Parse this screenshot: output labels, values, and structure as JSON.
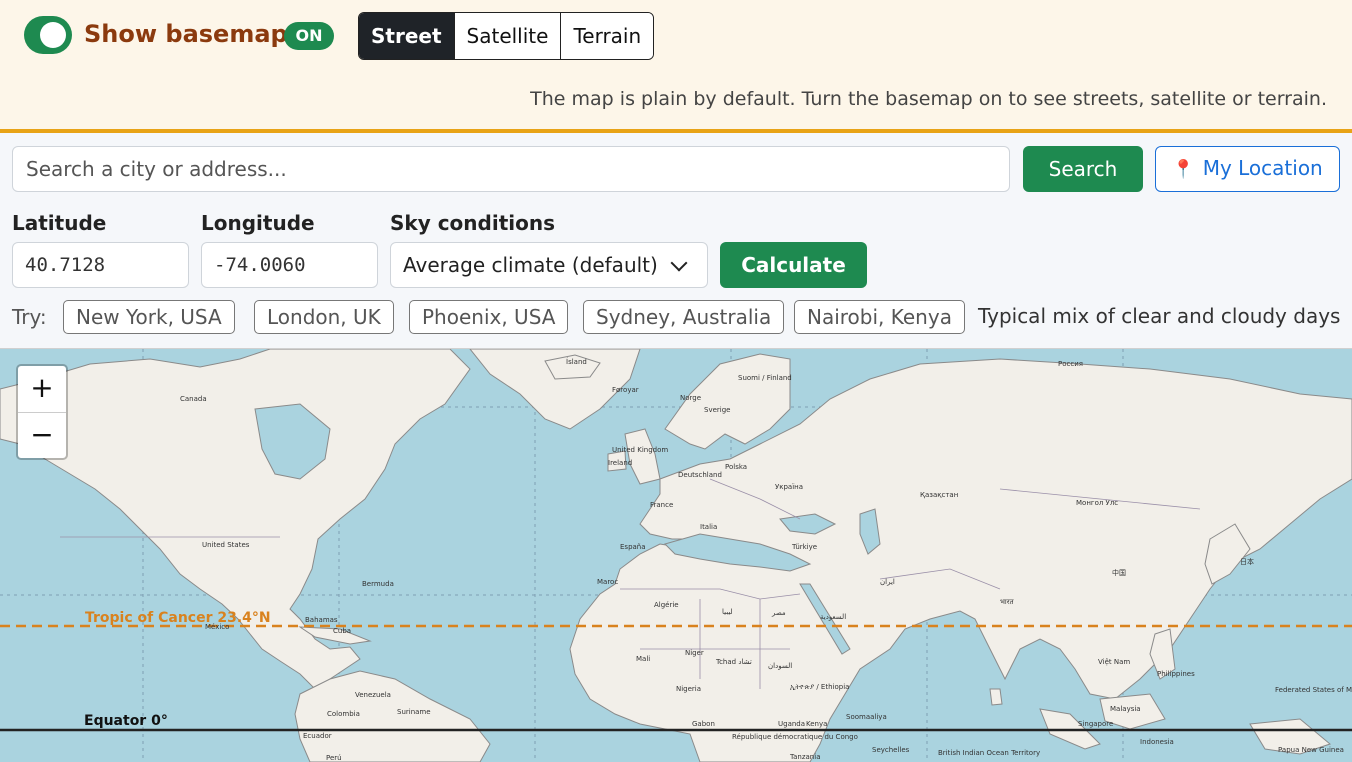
{
  "basemap_toggle": {
    "label": "Show basemap",
    "state": "ON"
  },
  "basemap_styles": [
    {
      "label": "Street",
      "active": true
    },
    {
      "label": "Satellite",
      "active": false
    },
    {
      "label": "Terrain",
      "active": false
    }
  ],
  "hint": "The map is plain by default. Turn the basemap on to see streets, satellite or terrain.",
  "search": {
    "placeholder": "Search a city or address...",
    "button": "Search",
    "location_button": "My Location",
    "location_icon": "pin-icon"
  },
  "fields": {
    "latitude_label": "Latitude",
    "latitude": "40.7128",
    "longitude_label": "Longitude",
    "longitude": "-74.0060",
    "sky_label": "Sky conditions",
    "sky_value": "Average climate (default)",
    "calculate": "Calculate"
  },
  "presets": {
    "label": "Try:",
    "items": [
      "New York, USA",
      "London, UK",
      "Phoenix, USA",
      "Sydney, Australia",
      "Nairobi, Kenya"
    ],
    "sky_note": "Typical mix of clear and cloudy days"
  },
  "map": {
    "zoom_in": "+",
    "zoom_out": "−",
    "lines": {
      "tropic": "Tropic of Cancer 23.4°N",
      "equator": "Equator 0°"
    },
    "labels": {
      "iceland": "Ísland",
      "canada": "Canada",
      "usa": "United States",
      "bermuda": "Bermuda",
      "mexico": "México",
      "bahamas": "Bahamas",
      "cuba": "Cuba",
      "venezuela": "Venezuela",
      "colombia": "Colombia",
      "ecuador": "Ecuador",
      "peru": "Perú",
      "suriname": "Suriname",
      "norge": "Norge",
      "sverige": "Sverige",
      "suomi": "Suomi / Finland",
      "uk": "United Kingdom",
      "ireland": "Ireland",
      "france": "France",
      "espana": "España",
      "deutschland": "Deutschland",
      "polska": "Polska",
      "ukraina": "Україна",
      "italia": "Italia",
      "turkiye": "Türkiye",
      "kazakhstan": "Қазақстан",
      "mongolia": "Монгол Улс",
      "russia": "Россия",
      "china": "中国",
      "japan": "日本",
      "algerie": "Algérie",
      "libya": "ليبيا",
      "egypt": "مصر",
      "mali": "Mali",
      "niger": "Niger",
      "tchad": "Tchad تشاد",
      "nigeria": "Nigeria",
      "sudan": "السودان",
      "ethiopia": "ኢትዮጵያ / Ethiopia",
      "kenya": "Kenya",
      "saudi": "السعودية",
      "iran": "ایران",
      "india": "भारत",
      "vietnam": "Việt Nam",
      "philippines": "Philippines",
      "indonesia": "Indonesia",
      "malaysia": "Malaysia",
      "singapore": "Singapore",
      "png": "Papua New Guinea",
      "micronesia": "Federated States of Micronesia",
      "faroe": "Føroyar",
      "maroc": "Maroc",
      "gabon": "Gabon",
      "rdc": "République démocratique du Congo",
      "tanzania": "Tanzania",
      "somalia": "Soomaaliya",
      "seychelles": "Seychelles",
      "biot": "British Indian Ocean Territory",
      "uganda": "Uganda"
    }
  }
}
